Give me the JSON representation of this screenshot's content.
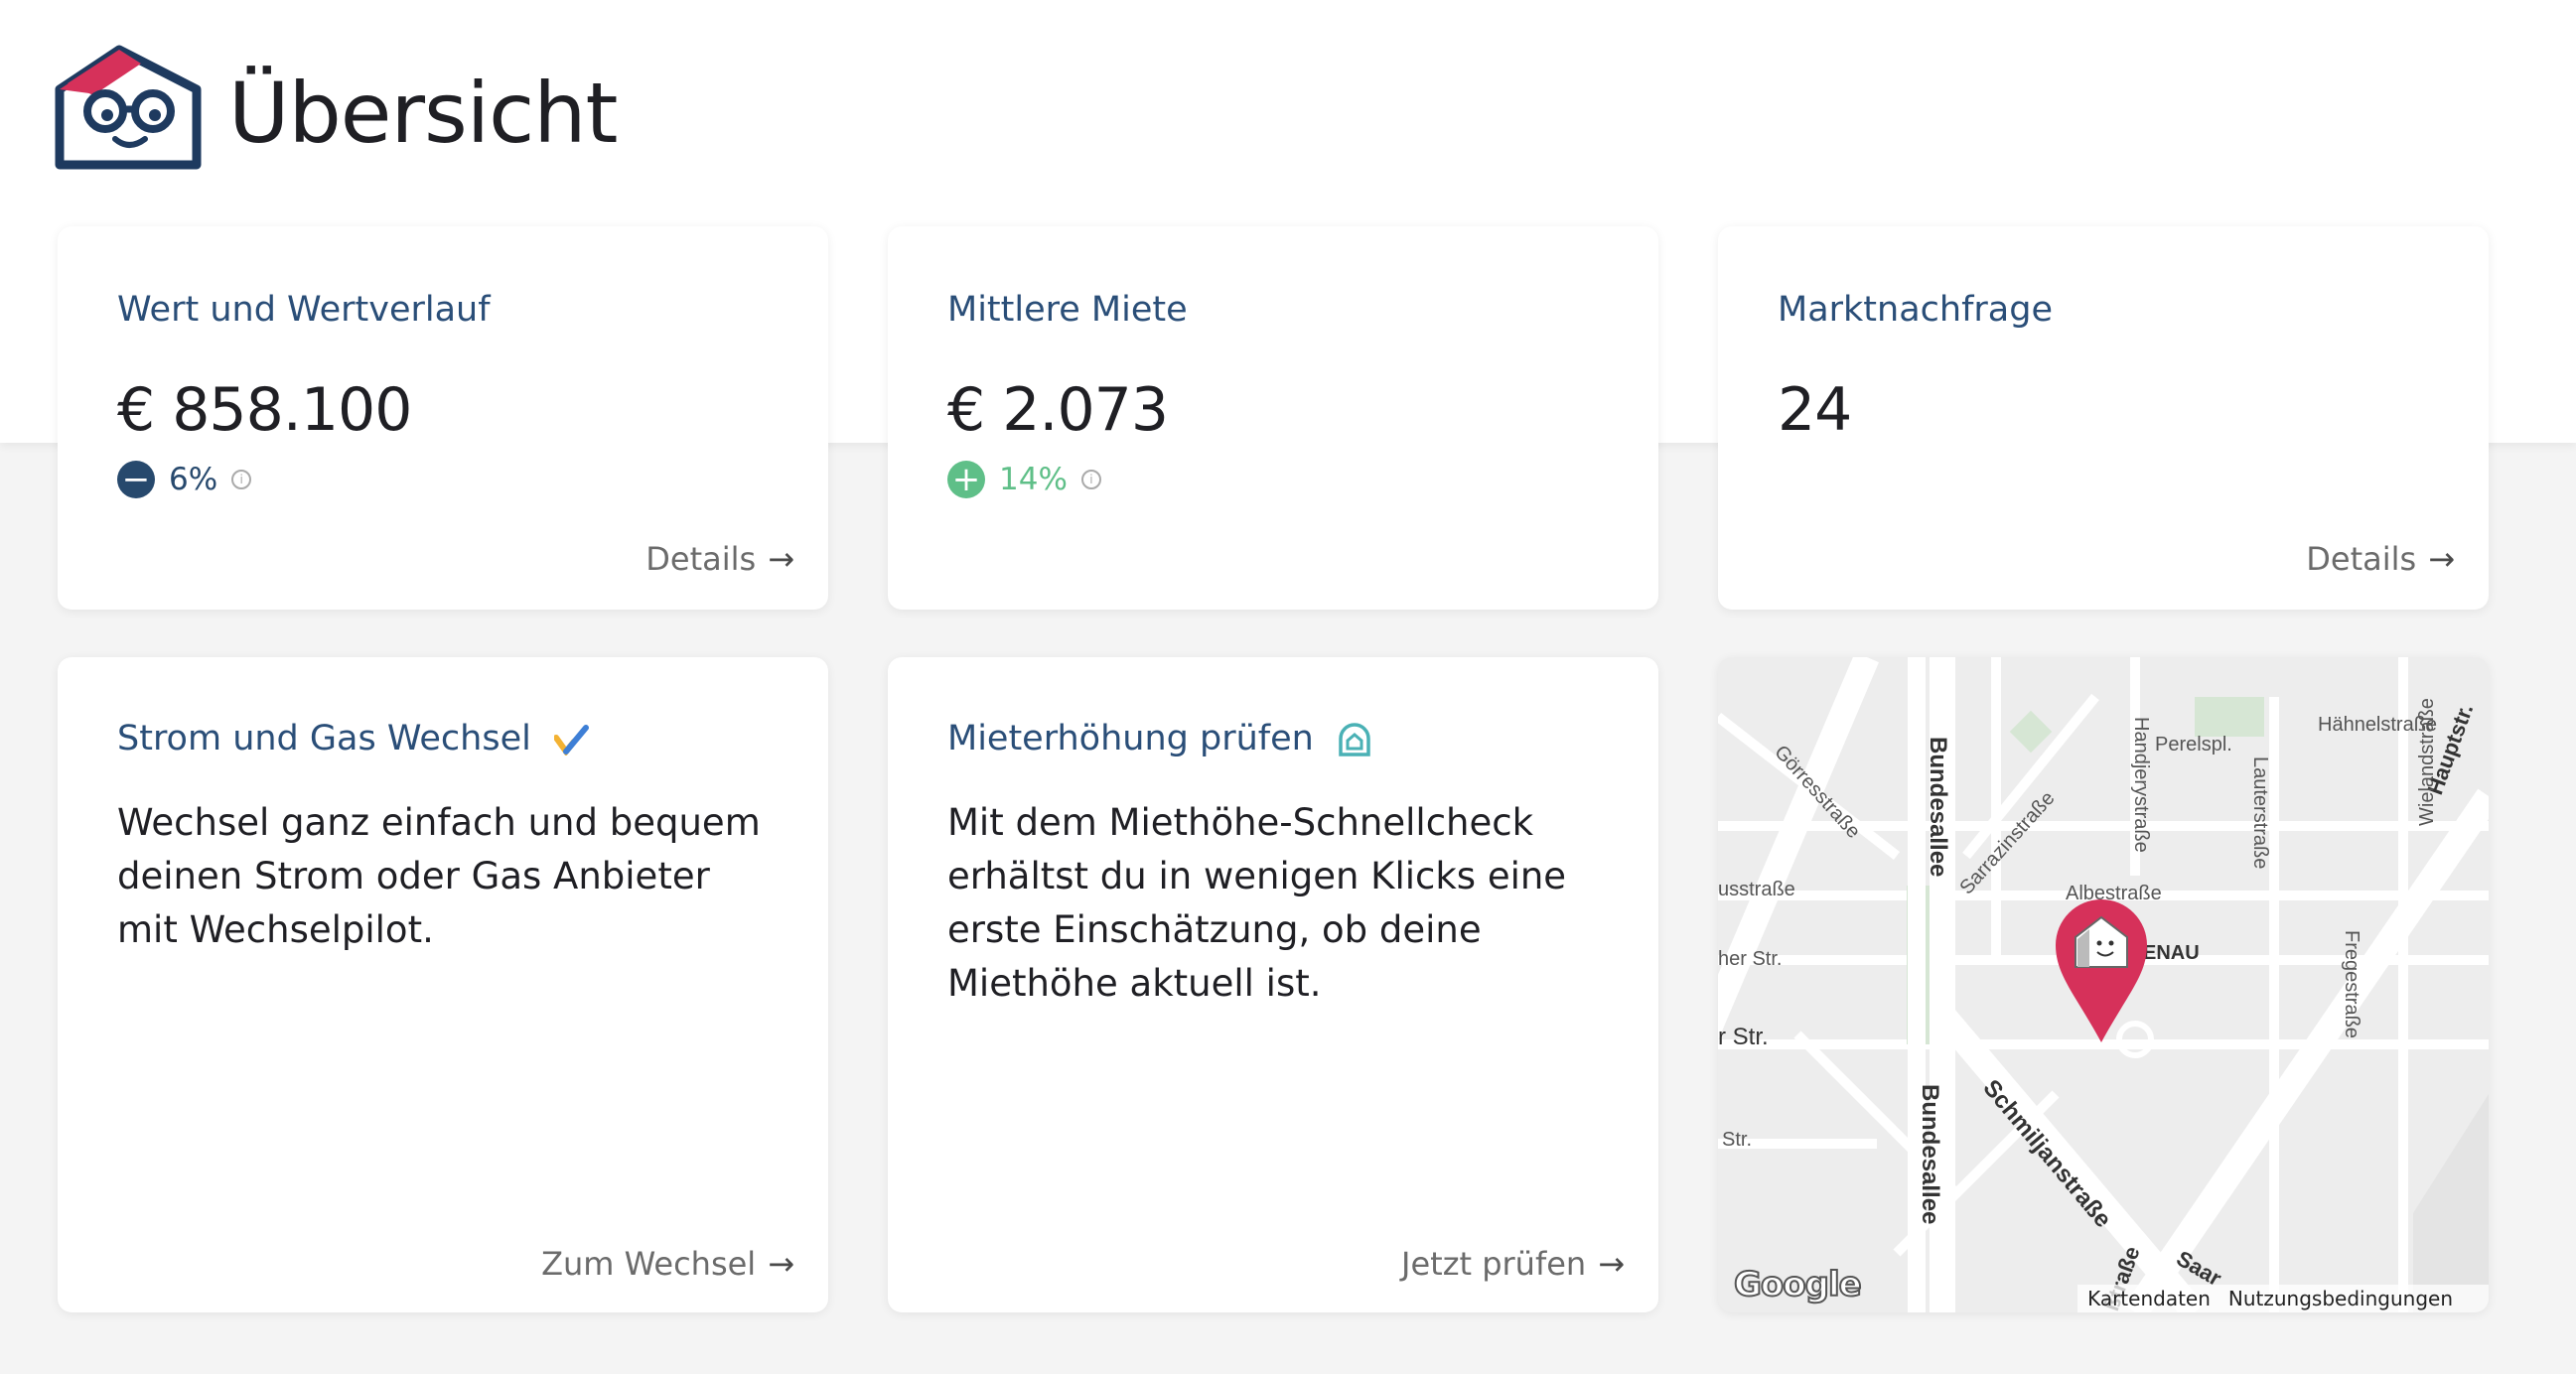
{
  "page": {
    "title": "Übersicht"
  },
  "colors": {
    "brand_blue": "#2a4e78",
    "brand_red": "#d6315a",
    "positive_green": "#5fbf88",
    "negative_blue": "#27496d"
  },
  "cards": {
    "value": {
      "title": "Wert und Wertverlauf",
      "amount": "€ 858.100",
      "change": "6%",
      "change_sign": "−",
      "link": "Details"
    },
    "rent": {
      "title": "Mittlere Miete",
      "amount": "€ 2.073",
      "change": "14%",
      "change_sign": "+"
    },
    "demand": {
      "title": "Marktnachfrage",
      "amount": "24",
      "link": "Details"
    },
    "energy": {
      "title": "Strom und Gas Wechsel",
      "icon": "wechselpilot-check-icon",
      "text": "Wechsel ganz einfach und bequem deinen Strom oder Gas Anbieter mit Wechselpilot.",
      "link": "Zum Wechsel"
    },
    "rent_check": {
      "title": "Mieterhöhung prüfen",
      "icon": "house-badge-icon",
      "text": "Mit dem Miethöhe-Schnellcheck erhältst du in wenigen Klicks eine erste Einschätzung, ob deine Miethöhe aktuell ist.",
      "link": "Jetzt prüfen"
    }
  },
  "map": {
    "streets": [
      "Bundesallee",
      "Bundesallee",
      "Görresstraße",
      "Sarrazinstraße",
      "Handjerystraße",
      "Lauterstraße",
      "Hähnelstraße",
      "Hauptstr.",
      "Wielandstraße",
      "Fregestraße",
      "Albestraße",
      "Schmiljanstraße",
      "usstraße",
      "her Str.",
      "r Str.",
      "Str.",
      "Perelspl.",
      "ENAU",
      "ßtraße",
      "Saar"
    ],
    "logo": "Google",
    "footer": [
      "Kartendaten",
      "Nutzungsbedingungen"
    ]
  }
}
